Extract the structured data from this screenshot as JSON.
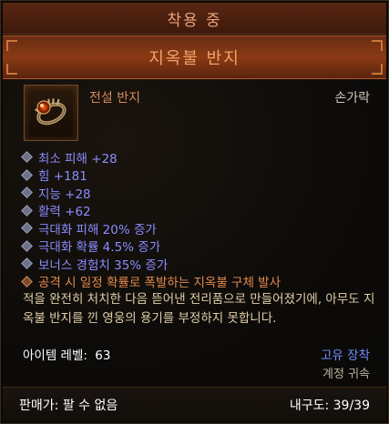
{
  "header": {
    "equipped_label": "착용 중",
    "item_name": "지옥불 반지"
  },
  "item": {
    "rarity_type": "전설 반지",
    "slot": "손가락",
    "icon": "ring-icon",
    "affixes": [
      "최소 피해 +28",
      "힘 +181",
      "지능 +28",
      "활력 +62",
      "극대화 피해 20% 증가",
      "극대화 확률 4.5% 증가",
      "보너스 경험치 35% 증가"
    ],
    "legendary_power": "공격 시 일정 확률로 폭발하는 지옥불 구체 발사",
    "flavor_text": "적을 완전히 처치한 다음 뜯어낸 전리품으로 만들어졌기에, 아무도 지옥불 반지를 낀 영웅의 용기를 부정하지 못합니다.",
    "item_level_label": "아이템 레벨:",
    "item_level": "63",
    "bound_label": "고유 장착",
    "account_bound_label": "계정 귀속"
  },
  "footer": {
    "sell_label": "판매가:",
    "sell_value": "팔 수 없음",
    "durability_label": "내구도:",
    "durability_value": "39/39"
  },
  "colors": {
    "affix": "#8b8dff",
    "legendary": "#e38a4e",
    "item_name": "#f0a468",
    "flavor": "#e0cfa8"
  }
}
